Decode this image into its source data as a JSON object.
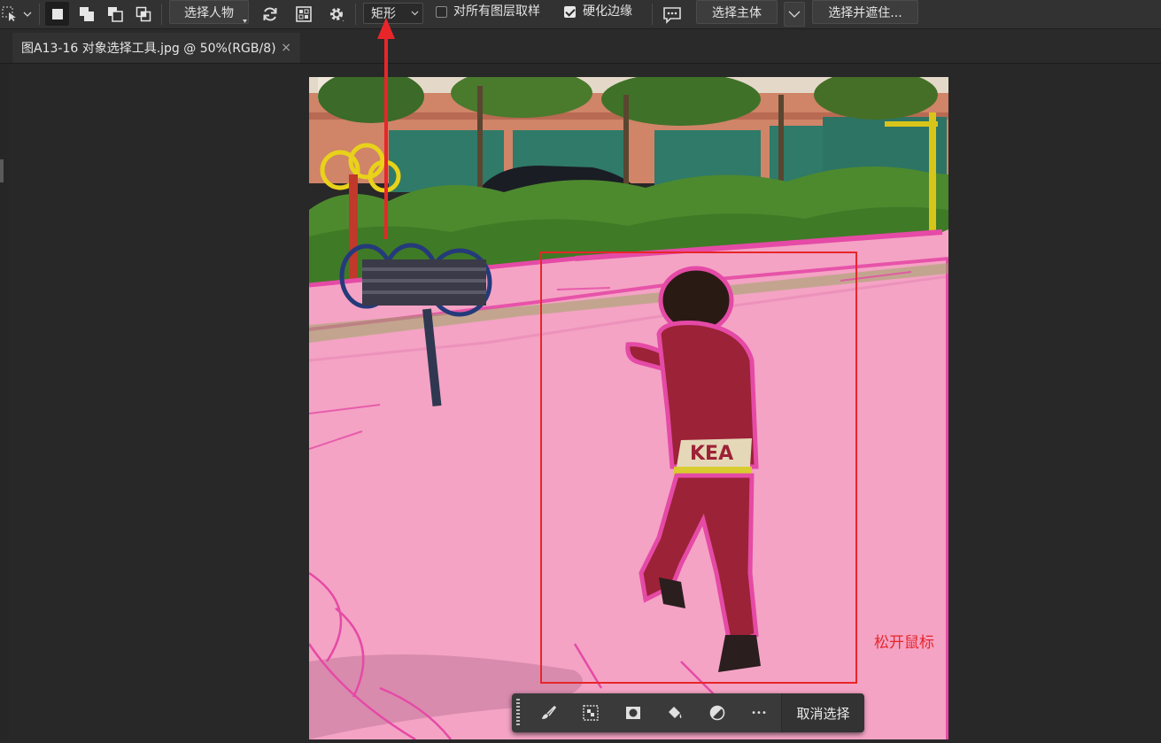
{
  "options_bar": {
    "select_person_label": "选择人物",
    "mode_value": "矩形",
    "sample_all_layers_label": "对所有图层取样",
    "sample_all_layers_checked": false,
    "hard_edge_label": "硬化边缘",
    "hard_edge_checked": true,
    "select_subject_label": "选择主体",
    "select_and_mask_label": "选择并遮住..."
  },
  "document_tab": {
    "title": "图A13-16 对象选择工具.jpg @ 50%(RGB/8)",
    "close_glyph": "×"
  },
  "annotation": {
    "text": "松开鼠标",
    "color": "#e8262a"
  },
  "task_bar": {
    "deselect_label": "取消选择",
    "more_glyph": "•••"
  },
  "colors": {
    "app_bg": "#282828",
    "options_bar_bg": "#323232",
    "overlay_pink": "#f4a3c4",
    "edge_magenta": "#e54aa6",
    "annotation_red": "#e8262a"
  }
}
